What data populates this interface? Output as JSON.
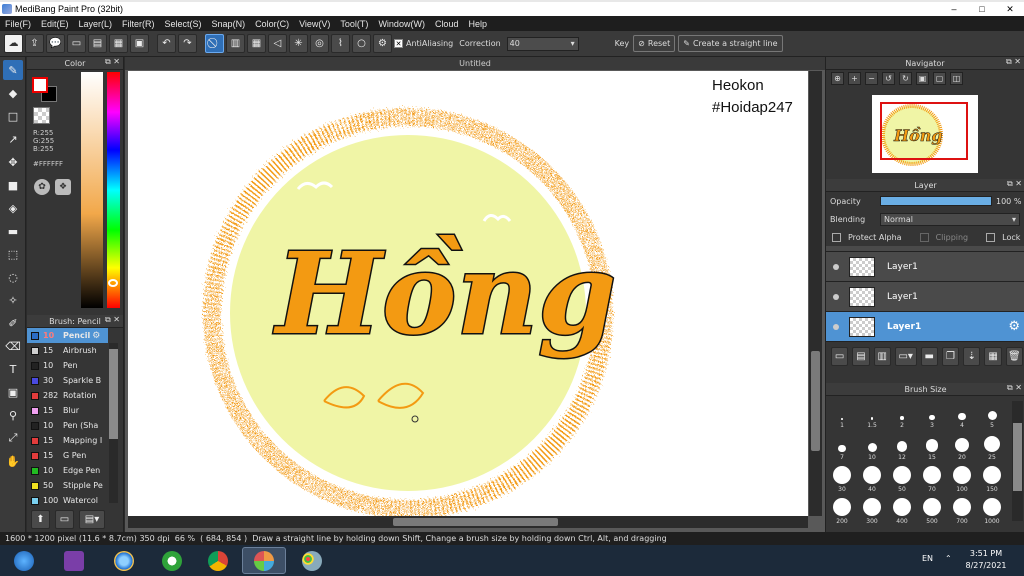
{
  "window": {
    "title": "MediBang Paint Pro (32bit)",
    "minimize": "–",
    "maximize": "□",
    "close": "✕"
  },
  "menu": [
    "File(F)",
    "Edit(E)",
    "Layer(L)",
    "Filter(R)",
    "Select(S)",
    "Snap(N)",
    "Color(C)",
    "View(V)",
    "Tool(T)",
    "Window(W)",
    "Cloud",
    "Help"
  ],
  "toolbar": {
    "antialiasing_label": "AntiAliasing",
    "antialiasing_checked": true,
    "correction_label": "Correction",
    "correction_value": "40",
    "key_label": "Key",
    "reset_label": "Reset",
    "straight_line_label": "Create a straight line"
  },
  "color_panel": {
    "title": "Color",
    "r": "R:255",
    "g": "G:255",
    "b": "B:255",
    "hex": "#FFFFFF"
  },
  "brush_panel": {
    "title": "Brush: Pencil",
    "items": [
      {
        "size": "10",
        "name": "Pencil",
        "color": "#2b6cc4",
        "selected": true
      },
      {
        "size": "15",
        "name": "Airbrush",
        "color": "#cfcfcf"
      },
      {
        "size": "10",
        "name": "Pen",
        "color": "#222222"
      },
      {
        "size": "30",
        "name": "Sparkle B",
        "color": "#4a4ae0"
      },
      {
        "size": "282",
        "name": "Rotation",
        "color": "#e23c3c"
      },
      {
        "size": "15",
        "name": "Blur",
        "color": "#f0a0f0"
      },
      {
        "size": "10",
        "name": "Pen (Sha",
        "color": "#222222"
      },
      {
        "size": "15",
        "name": "Mapping I",
        "color": "#e23c3c"
      },
      {
        "size": "15",
        "name": "G Pen",
        "color": "#e23c3c"
      },
      {
        "size": "10",
        "name": "Edge Pen",
        "color": "#22bb22"
      },
      {
        "size": "50",
        "name": "Stipple Pe",
        "color": "#f0e020"
      },
      {
        "size": "100",
        "name": "Watercol",
        "color": "#7ad0f0"
      }
    ]
  },
  "canvas": {
    "tab_title": "Untitled",
    "artwork_text": "Hồng",
    "watermark_line1": "Heokon",
    "watermark_line2": "#Hoidap247"
  },
  "navigator": {
    "title": "Navigator",
    "thumb_text": "Hồng"
  },
  "layer_panel": {
    "title": "Layer",
    "opacity_label": "Opacity",
    "opacity_value": "100 %",
    "opacity_fraction": 1.0,
    "blending_label": "Blending",
    "blending_value": "Normal",
    "protect_alpha": "Protect Alpha",
    "clipping": "Clipping",
    "lock": "Lock",
    "layers": [
      {
        "name": "Layer1",
        "selected": false
      },
      {
        "name": "Layer1",
        "selected": false
      },
      {
        "name": "Layer1",
        "selected": true
      }
    ]
  },
  "brush_size_panel": {
    "title": "Brush Size",
    "sizes": [
      "1",
      "1.5",
      "2",
      "3",
      "4",
      "5",
      "7",
      "10",
      "12",
      "15",
      "20",
      "25",
      "30",
      "40",
      "50",
      "70",
      "100",
      "150",
      "200",
      "300",
      "400",
      "500",
      "700",
      "1000"
    ]
  },
  "status": {
    "dimensions": "1600 * 1200 pixel",
    "physical": "(11.6 * 8.7cm)",
    "dpi": "350 dpi",
    "zoom": "66 %",
    "coords": "( 684, 854 )",
    "hint": "Draw a straight line by holding down Shift, Change a brush size by holding down Ctrl, Alt, and dragging"
  },
  "taskbar": {
    "lang": "EN",
    "time": "3:51 PM",
    "date": "8/27/2021"
  },
  "colors": {
    "accent": "#4f93d3",
    "art_fill": "#f0f5a6",
    "art_orange": "#f39a12"
  }
}
